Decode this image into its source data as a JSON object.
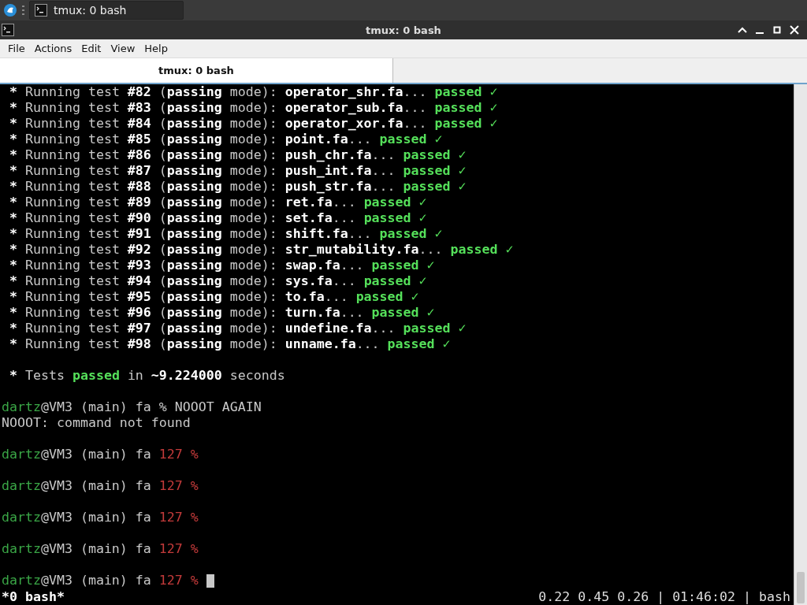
{
  "taskbar": {
    "task": {
      "label": "tmux: 0 bash",
      "selected": true
    }
  },
  "window": {
    "title": "tmux: 0 bash"
  },
  "menu": [
    "File",
    "Actions",
    "Edit",
    "View",
    "Help"
  ],
  "tabs": [
    {
      "label": "tmux: 0 bash",
      "selected": true
    }
  ],
  "terminal": {
    "lines": [
      {
        "kind": "text",
        "segments": [
          {
            "text": " * ",
            "kind": "bold"
          },
          {
            "text": "Running test ",
            "kind": "dim"
          },
          {
            "text": "#82",
            "kind": "bold"
          },
          {
            "text": " (",
            "kind": "dim"
          },
          {
            "text": "passing",
            "kind": "bold"
          },
          {
            "text": " mode): ",
            "kind": "dim"
          },
          {
            "text": "operator_shr.fa",
            "kind": "bold"
          },
          {
            "text": "... ",
            "kind": "dim"
          },
          {
            "text": "passed",
            "kind": "green"
          },
          {
            "text": " ✓",
            "kind": "check"
          }
        ]
      },
      {
        "kind": "text",
        "segments": [
          {
            "text": " * ",
            "kind": "bold"
          },
          {
            "text": "Running test ",
            "kind": "dim"
          },
          {
            "text": "#83",
            "kind": "bold"
          },
          {
            "text": " (",
            "kind": "dim"
          },
          {
            "text": "passing",
            "kind": "bold"
          },
          {
            "text": " mode): ",
            "kind": "dim"
          },
          {
            "text": "operator_sub.fa",
            "kind": "bold"
          },
          {
            "text": "... ",
            "kind": "dim"
          },
          {
            "text": "passed",
            "kind": "green"
          },
          {
            "text": " ✓",
            "kind": "check"
          }
        ]
      },
      {
        "kind": "text",
        "segments": [
          {
            "text": " * ",
            "kind": "bold"
          },
          {
            "text": "Running test ",
            "kind": "dim"
          },
          {
            "text": "#84",
            "kind": "bold"
          },
          {
            "text": " (",
            "kind": "dim"
          },
          {
            "text": "passing",
            "kind": "bold"
          },
          {
            "text": " mode): ",
            "kind": "dim"
          },
          {
            "text": "operator_xor.fa",
            "kind": "bold"
          },
          {
            "text": "... ",
            "kind": "dim"
          },
          {
            "text": "passed",
            "kind": "green"
          },
          {
            "text": " ✓",
            "kind": "check"
          }
        ]
      },
      {
        "kind": "text",
        "segments": [
          {
            "text": " * ",
            "kind": "bold"
          },
          {
            "text": "Running test ",
            "kind": "dim"
          },
          {
            "text": "#85",
            "kind": "bold"
          },
          {
            "text": " (",
            "kind": "dim"
          },
          {
            "text": "passing",
            "kind": "bold"
          },
          {
            "text": " mode): ",
            "kind": "dim"
          },
          {
            "text": "point.fa",
            "kind": "bold"
          },
          {
            "text": "... ",
            "kind": "dim"
          },
          {
            "text": "passed",
            "kind": "green"
          },
          {
            "text": " ✓",
            "kind": "check"
          }
        ]
      },
      {
        "kind": "text",
        "segments": [
          {
            "text": " * ",
            "kind": "bold"
          },
          {
            "text": "Running test ",
            "kind": "dim"
          },
          {
            "text": "#86",
            "kind": "bold"
          },
          {
            "text": " (",
            "kind": "dim"
          },
          {
            "text": "passing",
            "kind": "bold"
          },
          {
            "text": " mode): ",
            "kind": "dim"
          },
          {
            "text": "push_chr.fa",
            "kind": "bold"
          },
          {
            "text": "... ",
            "kind": "dim"
          },
          {
            "text": "passed",
            "kind": "green"
          },
          {
            "text": " ✓",
            "kind": "check"
          }
        ]
      },
      {
        "kind": "text",
        "segments": [
          {
            "text": " * ",
            "kind": "bold"
          },
          {
            "text": "Running test ",
            "kind": "dim"
          },
          {
            "text": "#87",
            "kind": "bold"
          },
          {
            "text": " (",
            "kind": "dim"
          },
          {
            "text": "passing",
            "kind": "bold"
          },
          {
            "text": " mode): ",
            "kind": "dim"
          },
          {
            "text": "push_int.fa",
            "kind": "bold"
          },
          {
            "text": "... ",
            "kind": "dim"
          },
          {
            "text": "passed",
            "kind": "green"
          },
          {
            "text": " ✓",
            "kind": "check"
          }
        ]
      },
      {
        "kind": "text",
        "segments": [
          {
            "text": " * ",
            "kind": "bold"
          },
          {
            "text": "Running test ",
            "kind": "dim"
          },
          {
            "text": "#88",
            "kind": "bold"
          },
          {
            "text": " (",
            "kind": "dim"
          },
          {
            "text": "passing",
            "kind": "bold"
          },
          {
            "text": " mode): ",
            "kind": "dim"
          },
          {
            "text": "push_str.fa",
            "kind": "bold"
          },
          {
            "text": "... ",
            "kind": "dim"
          },
          {
            "text": "passed",
            "kind": "green"
          },
          {
            "text": " ✓",
            "kind": "check"
          }
        ]
      },
      {
        "kind": "text",
        "segments": [
          {
            "text": " * ",
            "kind": "bold"
          },
          {
            "text": "Running test ",
            "kind": "dim"
          },
          {
            "text": "#89",
            "kind": "bold"
          },
          {
            "text": " (",
            "kind": "dim"
          },
          {
            "text": "passing",
            "kind": "bold"
          },
          {
            "text": " mode): ",
            "kind": "dim"
          },
          {
            "text": "ret.fa",
            "kind": "bold"
          },
          {
            "text": "... ",
            "kind": "dim"
          },
          {
            "text": "passed",
            "kind": "green"
          },
          {
            "text": " ✓",
            "kind": "check"
          }
        ]
      },
      {
        "kind": "text",
        "segments": [
          {
            "text": " * ",
            "kind": "bold"
          },
          {
            "text": "Running test ",
            "kind": "dim"
          },
          {
            "text": "#90",
            "kind": "bold"
          },
          {
            "text": " (",
            "kind": "dim"
          },
          {
            "text": "passing",
            "kind": "bold"
          },
          {
            "text": " mode): ",
            "kind": "dim"
          },
          {
            "text": "set.fa",
            "kind": "bold"
          },
          {
            "text": "... ",
            "kind": "dim"
          },
          {
            "text": "passed",
            "kind": "green"
          },
          {
            "text": " ✓",
            "kind": "check"
          }
        ]
      },
      {
        "kind": "text",
        "segments": [
          {
            "text": " * ",
            "kind": "bold"
          },
          {
            "text": "Running test ",
            "kind": "dim"
          },
          {
            "text": "#91",
            "kind": "bold"
          },
          {
            "text": " (",
            "kind": "dim"
          },
          {
            "text": "passing",
            "kind": "bold"
          },
          {
            "text": " mode): ",
            "kind": "dim"
          },
          {
            "text": "shift.fa",
            "kind": "bold"
          },
          {
            "text": "... ",
            "kind": "dim"
          },
          {
            "text": "passed",
            "kind": "green"
          },
          {
            "text": " ✓",
            "kind": "check"
          }
        ]
      },
      {
        "kind": "text",
        "segments": [
          {
            "text": " * ",
            "kind": "bold"
          },
          {
            "text": "Running test ",
            "kind": "dim"
          },
          {
            "text": "#92",
            "kind": "bold"
          },
          {
            "text": " (",
            "kind": "dim"
          },
          {
            "text": "passing",
            "kind": "bold"
          },
          {
            "text": " mode): ",
            "kind": "dim"
          },
          {
            "text": "str_mutability.fa",
            "kind": "bold"
          },
          {
            "text": "... ",
            "kind": "dim"
          },
          {
            "text": "passed",
            "kind": "green"
          },
          {
            "text": " ✓",
            "kind": "check"
          }
        ]
      },
      {
        "kind": "text",
        "segments": [
          {
            "text": " * ",
            "kind": "bold"
          },
          {
            "text": "Running test ",
            "kind": "dim"
          },
          {
            "text": "#93",
            "kind": "bold"
          },
          {
            "text": " (",
            "kind": "dim"
          },
          {
            "text": "passing",
            "kind": "bold"
          },
          {
            "text": " mode): ",
            "kind": "dim"
          },
          {
            "text": "swap.fa",
            "kind": "bold"
          },
          {
            "text": "... ",
            "kind": "dim"
          },
          {
            "text": "passed",
            "kind": "green"
          },
          {
            "text": " ✓",
            "kind": "check"
          }
        ]
      },
      {
        "kind": "text",
        "segments": [
          {
            "text": " * ",
            "kind": "bold"
          },
          {
            "text": "Running test ",
            "kind": "dim"
          },
          {
            "text": "#94",
            "kind": "bold"
          },
          {
            "text": " (",
            "kind": "dim"
          },
          {
            "text": "passing",
            "kind": "bold"
          },
          {
            "text": " mode): ",
            "kind": "dim"
          },
          {
            "text": "sys.fa",
            "kind": "bold"
          },
          {
            "text": "... ",
            "kind": "dim"
          },
          {
            "text": "passed",
            "kind": "green"
          },
          {
            "text": " ✓",
            "kind": "check"
          }
        ]
      },
      {
        "kind": "text",
        "segments": [
          {
            "text": " * ",
            "kind": "bold"
          },
          {
            "text": "Running test ",
            "kind": "dim"
          },
          {
            "text": "#95",
            "kind": "bold"
          },
          {
            "text": " (",
            "kind": "dim"
          },
          {
            "text": "passing",
            "kind": "bold"
          },
          {
            "text": " mode): ",
            "kind": "dim"
          },
          {
            "text": "to.fa",
            "kind": "bold"
          },
          {
            "text": "... ",
            "kind": "dim"
          },
          {
            "text": "passed",
            "kind": "green"
          },
          {
            "text": " ✓",
            "kind": "check"
          }
        ]
      },
      {
        "kind": "text",
        "segments": [
          {
            "text": " * ",
            "kind": "bold"
          },
          {
            "text": "Running test ",
            "kind": "dim"
          },
          {
            "text": "#96",
            "kind": "bold"
          },
          {
            "text": " (",
            "kind": "dim"
          },
          {
            "text": "passing",
            "kind": "bold"
          },
          {
            "text": " mode): ",
            "kind": "dim"
          },
          {
            "text": "turn.fa",
            "kind": "bold"
          },
          {
            "text": "... ",
            "kind": "dim"
          },
          {
            "text": "passed",
            "kind": "green"
          },
          {
            "text": " ✓",
            "kind": "check"
          }
        ]
      },
      {
        "kind": "text",
        "segments": [
          {
            "text": " * ",
            "kind": "bold"
          },
          {
            "text": "Running test ",
            "kind": "dim"
          },
          {
            "text": "#97",
            "kind": "bold"
          },
          {
            "text": " (",
            "kind": "dim"
          },
          {
            "text": "passing",
            "kind": "bold"
          },
          {
            "text": " mode): ",
            "kind": "dim"
          },
          {
            "text": "undefine.fa",
            "kind": "bold"
          },
          {
            "text": "... ",
            "kind": "dim"
          },
          {
            "text": "passed",
            "kind": "green"
          },
          {
            "text": " ✓",
            "kind": "check"
          }
        ]
      },
      {
        "kind": "text",
        "segments": [
          {
            "text": " * ",
            "kind": "bold"
          },
          {
            "text": "Running test ",
            "kind": "dim"
          },
          {
            "text": "#98",
            "kind": "bold"
          },
          {
            "text": " (",
            "kind": "dim"
          },
          {
            "text": "passing",
            "kind": "bold"
          },
          {
            "text": " mode): ",
            "kind": "dim"
          },
          {
            "text": "unname.fa",
            "kind": "bold"
          },
          {
            "text": "... ",
            "kind": "dim"
          },
          {
            "text": "passed",
            "kind": "green"
          },
          {
            "text": " ✓",
            "kind": "check"
          }
        ]
      },
      {
        "kind": "blank"
      },
      {
        "kind": "text",
        "segments": [
          {
            "text": " * ",
            "kind": "bold"
          },
          {
            "text": "Tests ",
            "kind": "dim"
          },
          {
            "text": "passed",
            "kind": "green"
          },
          {
            "text": " in ",
            "kind": "dim"
          },
          {
            "text": "~9.224000",
            "kind": "bold"
          },
          {
            "text": " seconds",
            "kind": "dim"
          }
        ]
      },
      {
        "kind": "blank"
      },
      {
        "kind": "text",
        "segments": [
          {
            "text": "dartz",
            "kind": "prompt"
          },
          {
            "text": "@VM3 (main) fa % NOOOT AGAIN",
            "kind": "dim"
          }
        ]
      },
      {
        "kind": "text",
        "segments": [
          {
            "text": "NOOOT: command not found",
            "kind": "dim"
          }
        ]
      },
      {
        "kind": "blank"
      },
      {
        "kind": "text",
        "segments": [
          {
            "text": "dartz",
            "kind": "prompt"
          },
          {
            "text": "@VM3 (main) fa ",
            "kind": "dim"
          },
          {
            "text": "127 %",
            "kind": "error"
          }
        ]
      },
      {
        "kind": "blank"
      },
      {
        "kind": "text",
        "segments": [
          {
            "text": "dartz",
            "kind": "prompt"
          },
          {
            "text": "@VM3 (main) fa ",
            "kind": "dim"
          },
          {
            "text": "127 %",
            "kind": "error"
          }
        ]
      },
      {
        "kind": "blank"
      },
      {
        "kind": "text",
        "segments": [
          {
            "text": "dartz",
            "kind": "prompt"
          },
          {
            "text": "@VM3 (main) fa ",
            "kind": "dim"
          },
          {
            "text": "127 %",
            "kind": "error"
          }
        ]
      },
      {
        "kind": "blank"
      },
      {
        "kind": "text",
        "segments": [
          {
            "text": "dartz",
            "kind": "prompt"
          },
          {
            "text": "@VM3 (main) fa ",
            "kind": "dim"
          },
          {
            "text": "127 %",
            "kind": "error"
          }
        ]
      },
      {
        "kind": "blank"
      },
      {
        "kind": "text",
        "cursor": true,
        "segments": [
          {
            "text": "dartz",
            "kind": "prompt"
          },
          {
            "text": "@VM3 (main) fa ",
            "kind": "dim"
          },
          {
            "text": "127 %",
            "kind": "error"
          }
        ]
      }
    ]
  },
  "status_bar": {
    "window_list": "*0 bash*",
    "status": "0.22 0.45 0.26 | 01:46:02 | bash"
  }
}
